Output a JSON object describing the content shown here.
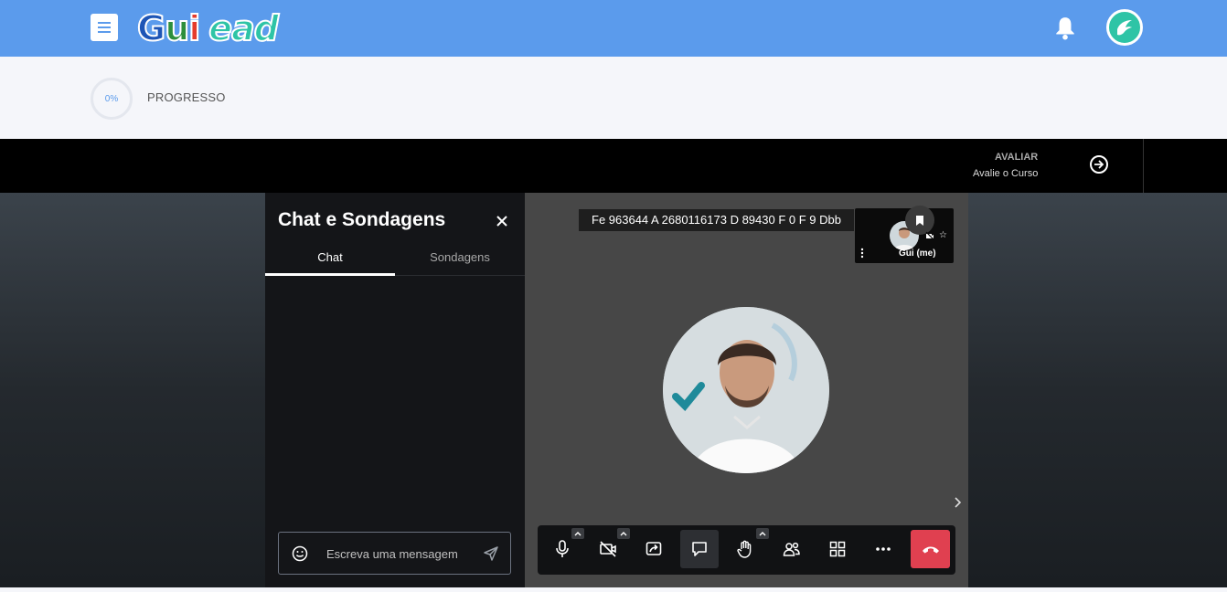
{
  "header": {
    "logo_parts": [
      "G",
      "u",
      "i",
      "ead"
    ],
    "colors": {
      "topbar": "#5b9bec",
      "logo_accent": "#2ec4a6"
    }
  },
  "progress": {
    "value": "0%",
    "label": "PROGRESSO"
  },
  "evaluate": {
    "title": "AVALIAR",
    "subtitle": "Avalie o Curso"
  },
  "chat": {
    "title": "Chat e Sondagens",
    "tabs": [
      {
        "label": "Chat",
        "active": true
      },
      {
        "label": "Sondagens",
        "active": false
      }
    ],
    "input_placeholder": "Escreva uma mensagem"
  },
  "video": {
    "meeting_id": "Fe 963644 A 2680116173 D 89430 F 0 F 9 Dbb",
    "self_name": "Gui (me)"
  },
  "toolbar": {
    "buttons": [
      "microphone-icon",
      "camera-off-icon",
      "share-screen-icon",
      "chat-icon",
      "raise-hand-icon",
      "participants-icon",
      "tile-view-icon",
      "more-icon",
      "hangup-icon"
    ],
    "hangup_color": "#e04050"
  }
}
